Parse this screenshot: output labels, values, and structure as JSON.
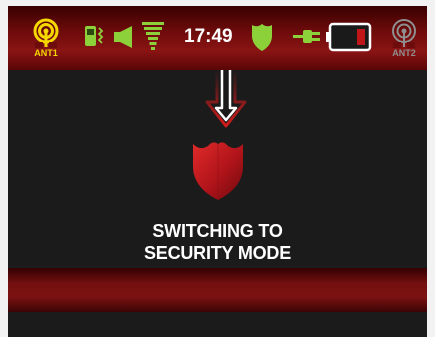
{
  "status_bar": {
    "ant1_label": "ANT1",
    "ant2_label": "ANT2",
    "time": "17:49",
    "battery_level": 0.15,
    "icons": {
      "ant1": "antenna-signal-icon",
      "cell": "mobile-vibrate-icon",
      "speaker": "speaker-icon",
      "signal": "signal-strength-icon",
      "shield": "shield-icon",
      "plug": "power-plug-icon",
      "battery": "battery-icon",
      "ant2": "antenna-signal-icon"
    }
  },
  "main": {
    "message_line1": "SWITCHING TO",
    "message_line2": "SECURITY MODE",
    "icons": {
      "arrow": "arrow-down-icon",
      "shield": "shield-icon"
    }
  },
  "colors": {
    "accent_yellow": "#f5d800",
    "accent_green": "#8cd13a",
    "alert_red": "#c0161a",
    "text_white": "#ffffff",
    "inactive_gray": "#8f8f8f"
  }
}
